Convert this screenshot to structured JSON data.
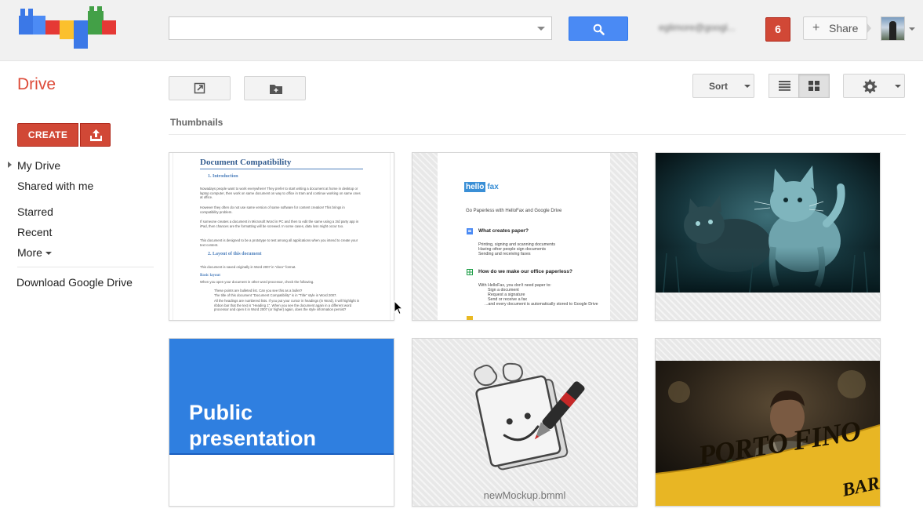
{
  "header": {
    "search": {
      "value": "",
      "placeholder": ""
    },
    "account_email": "eglimore@googl...",
    "notifications_count": "6",
    "share_label": "Share"
  },
  "toolbar": {
    "app_title": "Drive",
    "sort_label": "Sort",
    "active_view": "grid"
  },
  "sidebar": {
    "create_label": "CREATE",
    "items": [
      {
        "label": "My Drive"
      },
      {
        "label": "Shared with me"
      },
      {
        "label": "Starred"
      },
      {
        "label": "Recent"
      },
      {
        "label": "More"
      }
    ],
    "download_label": "Download Google Drive"
  },
  "content": {
    "section_label": "Thumbnails",
    "files": [
      {
        "kind": "document",
        "doc": {
          "title": "Document Compatibility",
          "h1": "1. Introduction",
          "p1": "Nowadays people want to work everywhere! They prefer to start writing a document at home in desktop or laptop computer, then work on same document on way to office in tram and continue working on same ones at office.",
          "p2": "However they often do not use same version of same software for content creation! This brings in compatibility problem.",
          "p3": "If someone creates a document in Microsoft Word in PC and then to edit the same using a 3rd party app in iPad, then chances are the formatting will be screwed. In some cases, data loss might occur too.",
          "p4": "This document is designed to be a prototype to test among all applications when you intend to create your text content.",
          "h2": "2. Layout of this document",
          "p5": "This document is saved originally in Word 2007 in \"docx\" format.",
          "h3": "Basic layout",
          "p6": "When you open your document in other word processor, check the following.",
          "p7": "These points are bulleted list. Can you see this as a bullet?",
          "p8": "The title of this document \"Document Compatibility\" is in \"Title\" style in Word 2007.",
          "p9": "All the headings are numbered lists. If you put your cursor in headings (in Word), it will highlight in ribbon bar that the text is \"Heading 1\". When you see the document again in a different word processor and open it in Word 2007 (or higher) again, does the style information persist?"
        }
      },
      {
        "kind": "document",
        "hellofax": {
          "logo_hello": "hello",
          "logo_fax": "fax",
          "subtitle": "Go Paperless with HelloFax and Google Drive",
          "q1": "What creates paper?",
          "l1": [
            "Printing, signing and scanning documents",
            "Having other people sign documents",
            "Sending and receiving faxes"
          ],
          "q2": "How do we make our office paperless?",
          "l2": [
            "With HelloFax, you don't need paper to:",
            "Sign a document",
            "Request a signature",
            "Send or receive a fax",
            "...and every document is automatically stored to Google Drive"
          ]
        }
      },
      {
        "kind": "image",
        "subject": "kitten-photo"
      },
      {
        "kind": "presentation",
        "title_line1": "Public",
        "title_line2": "presentation"
      },
      {
        "kind": "mockup",
        "name": "newMockup.bmml"
      },
      {
        "kind": "image",
        "subject": "porto-fino-bar-photo",
        "sign_line1": "PORTO FINO",
        "sign_line2": "BAR"
      }
    ]
  },
  "colors": {
    "brand_red": "#dd4b39",
    "create_red": "#d14836",
    "search_blue": "#4a8af4",
    "presentation_blue": "#2f7fe0"
  }
}
